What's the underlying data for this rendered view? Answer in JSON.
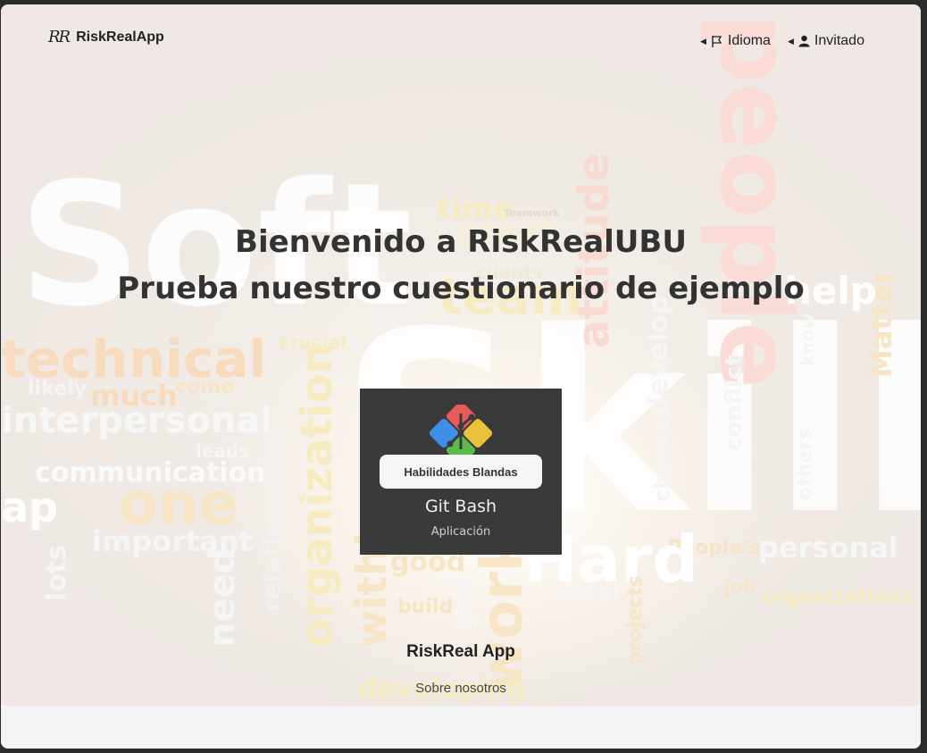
{
  "nav": {
    "brand_logo": "RR",
    "brand_name": "RiskRealApp",
    "language_label": "Idioma",
    "user_label": "Invitado"
  },
  "hero": {
    "title": "Bienvenido a RiskRealUBU",
    "subtitle": "Prueba nuestro cuestionario de ejemplo"
  },
  "card": {
    "category": "Habilidades Blandas",
    "app_name": "Git Bash",
    "app_type": "Aplicación"
  },
  "footer": {
    "title": "RiskReal App",
    "about_link": "Sobre nosotros"
  },
  "background_words": [
    "Soft",
    "Skills",
    "people",
    "technical",
    "interpersonal",
    "communication",
    "one",
    "organization",
    "relationships",
    "important",
    "much",
    "come",
    "crucial",
    "attitude",
    "team",
    "time",
    "help",
    "personal",
    "People's",
    "organizations",
    "excel",
    "Hard",
    "good",
    "need",
    "lots",
    "within",
    "develop",
    "conflict",
    "others",
    "Matter",
    "know",
    "chances",
    "Teamwork",
    "clients",
    "great",
    "leads",
    "likely",
    "ap",
    "build",
    "get",
    "projects",
    "job",
    "developing",
    "work"
  ],
  "colors": {
    "card_bg": "#3a3a3a",
    "pill_bg": "#f6f6f6",
    "text_dark": "#333333",
    "window_bg": "#2b2b2b"
  }
}
